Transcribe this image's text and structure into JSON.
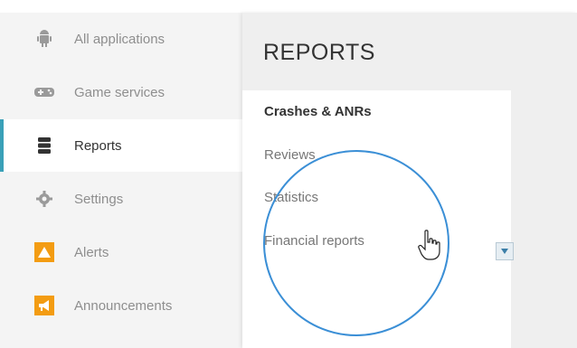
{
  "sidebar": {
    "items": [
      {
        "label": "All applications",
        "icon": "android-icon",
        "active": false
      },
      {
        "label": "Game services",
        "icon": "gamepad-icon",
        "active": false
      },
      {
        "label": "Reports",
        "icon": "database-icon",
        "active": true
      },
      {
        "label": "Settings",
        "icon": "gear-icon",
        "active": false
      },
      {
        "label": "Alerts",
        "icon": "warning-icon",
        "active": false
      },
      {
        "label": "Announcements",
        "icon": "megaphone-icon",
        "active": false
      }
    ]
  },
  "submenu": {
    "title": "REPORTS",
    "items": [
      {
        "label": "Crashes & ANRs"
      },
      {
        "label": "Reviews"
      },
      {
        "label": "Statistics"
      },
      {
        "label": "Financial reports"
      }
    ]
  },
  "colors": {
    "accent": "#3aa0b8",
    "highlight_circle": "#3b8fd6",
    "alert_orange": "#f39c12"
  }
}
